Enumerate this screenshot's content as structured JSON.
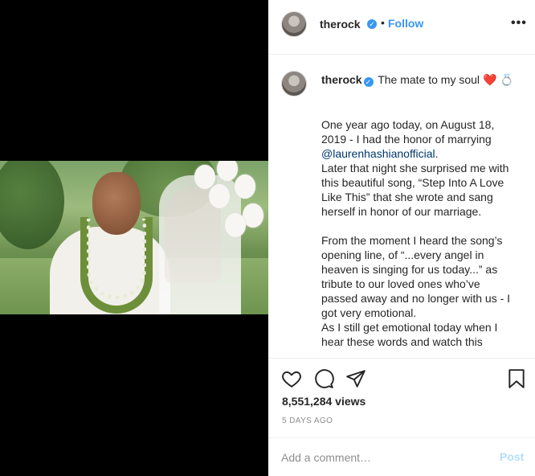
{
  "post": {
    "username": "therock",
    "verified_glyph": "✓",
    "follow_label": "Follow",
    "separator": "•",
    "more_label": "•••",
    "caption_title": "The mate to my soul",
    "caption_emojis": "❤️ 💍",
    "caption_paragraphs": [
      "One year ago today, on August 18, 2019 - I had the honor of marrying",
      "@laurenhashianofficial",
      ".",
      "Later that night she surprised me with this beautiful song, “Step Into A Love Like This” that she wrote and sang herself in honor of our marriage.",
      "From the moment I heard the song’s opening line, of “...every angel in heaven is singing for us today...” as tribute to our loved ones who’ve passed away and no longer with us - I got very emotional.",
      "As I still get emotional today when I hear these words and watch this"
    ],
    "views": "8,551,284 views",
    "age": "5 DAYS AGO",
    "comment_placeholder": "Add a comment…",
    "post_label": "Post"
  },
  "icons": {
    "like": "heart-icon",
    "comment": "comment-icon",
    "share": "share-icon",
    "save": "bookmark-icon",
    "more": "more-options-icon",
    "verified": "verified-badge-icon"
  },
  "colors": {
    "accent": "#3897f0",
    "post_disabled": "#b2dffc",
    "mention": "#00376b",
    "muted": "#8e8e8e"
  }
}
